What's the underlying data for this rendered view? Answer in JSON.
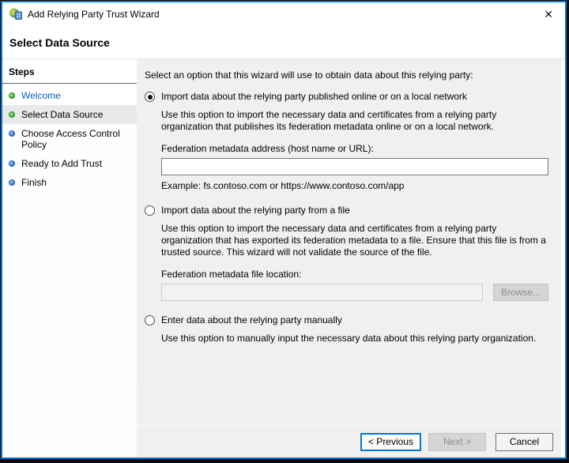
{
  "window": {
    "title": "Add Relying Party Trust Wizard"
  },
  "icons": {
    "app": "relying-party-trust-icon",
    "close": "✕"
  },
  "header": {
    "title": "Select Data Source"
  },
  "sidebar": {
    "title": "Steps",
    "items": [
      {
        "label": "Welcome",
        "status": "completed"
      },
      {
        "label": "Select Data Source",
        "status": "current"
      },
      {
        "label": "Choose Access Control Policy",
        "status": "upcoming"
      },
      {
        "label": "Ready to Add Trust",
        "status": "upcoming"
      },
      {
        "label": "Finish",
        "status": "upcoming"
      }
    ]
  },
  "main": {
    "intro": "Select an option that this wizard will use to obtain data about this relying party:",
    "options": [
      {
        "label": "Import data about the relying party published online or on a local network",
        "selected": true,
        "description": "Use this option to import the necessary data and certificates from a relying party organization that publishes its federation metadata online or on a local network.",
        "field_label": "Federation metadata address (host name or URL):",
        "field_value": "",
        "example": "Example: fs.contoso.com or https://www.contoso.com/app"
      },
      {
        "label": "Import data about the relying party from a file",
        "selected": false,
        "description": "Use this option to import the necessary data and certificates from a relying party organization that has exported its federation metadata to a file. Ensure that this file is from a trusted source.  This wizard will not validate the source of the file.",
        "field_label": "Federation metadata file location:",
        "field_value": "",
        "browse_label": "Browse..."
      },
      {
        "label": "Enter data about the relying party manually",
        "selected": false,
        "description": "Use this option to manually input the necessary data about this relying party organization."
      }
    ]
  },
  "footer": {
    "buttons": [
      {
        "label": "< Previous",
        "enabled": true,
        "default": true
      },
      {
        "label": "Next >",
        "enabled": false,
        "default": false
      },
      {
        "label": "Cancel",
        "enabled": true,
        "default": false
      }
    ]
  },
  "colors": {
    "window_border": "#0078d7",
    "accent": "#0078d7",
    "panel_bg": "#f0f0f0",
    "sidebar_highlight": "#e9e9e9",
    "link_blue": "#0563c1",
    "step_done_green": "#3cb43c",
    "step_todo_blue": "#2f7fd6",
    "disabled_text": "#8d8d8d"
  }
}
